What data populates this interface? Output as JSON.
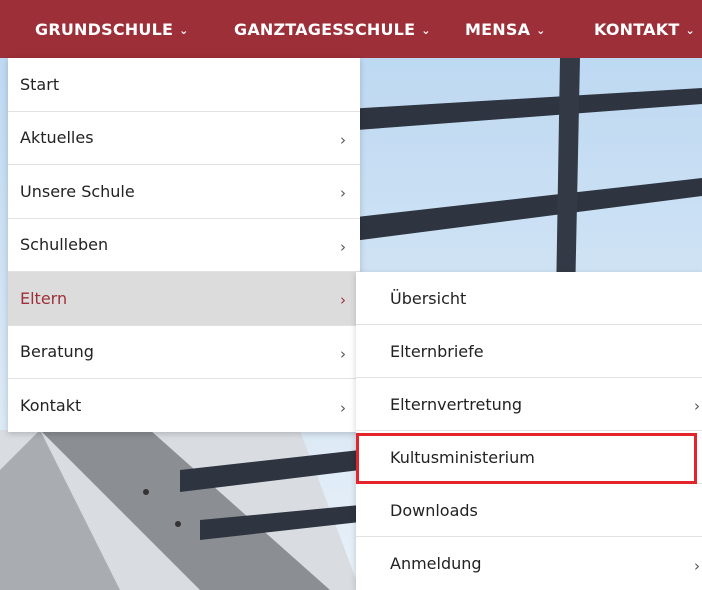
{
  "top_nav": {
    "items": [
      {
        "label": "GRUNDSCHULE",
        "icon": "chevron-down-icon"
      },
      {
        "label": "GANZTAGESSCHULE",
        "icon": "chevron-down-icon"
      },
      {
        "label": "MENSA",
        "icon": "chevron-down-icon"
      },
      {
        "label": "KONTAKT",
        "icon": "chevron-down-icon"
      }
    ]
  },
  "menu_level1": {
    "items": [
      {
        "label": "Start",
        "has_submenu": false
      },
      {
        "label": "Aktuelles",
        "has_submenu": true
      },
      {
        "label": "Unsere Schule",
        "has_submenu": true
      },
      {
        "label": "Schulleben",
        "has_submenu": true
      },
      {
        "label": "Eltern",
        "has_submenu": true,
        "active": true
      },
      {
        "label": "Beratung",
        "has_submenu": true
      },
      {
        "label": "Kontakt",
        "has_submenu": true
      }
    ]
  },
  "menu_level2": {
    "items": [
      {
        "label": "Übersicht",
        "has_submenu": false
      },
      {
        "label": "Elternbriefe",
        "has_submenu": false
      },
      {
        "label": "Elternvertretung",
        "has_submenu": true
      },
      {
        "label": "Kultusministerium",
        "has_submenu": false,
        "highlighted": true
      },
      {
        "label": "Downloads",
        "has_submenu": false
      },
      {
        "label": "Anmeldung",
        "has_submenu": true
      }
    ]
  },
  "glyphs": {
    "chevron_down": "⌄",
    "chevron_right": "›"
  },
  "colors": {
    "brand": "#9c2f38",
    "active_bg": "#dcdcdc",
    "highlight": "#e3242b"
  }
}
